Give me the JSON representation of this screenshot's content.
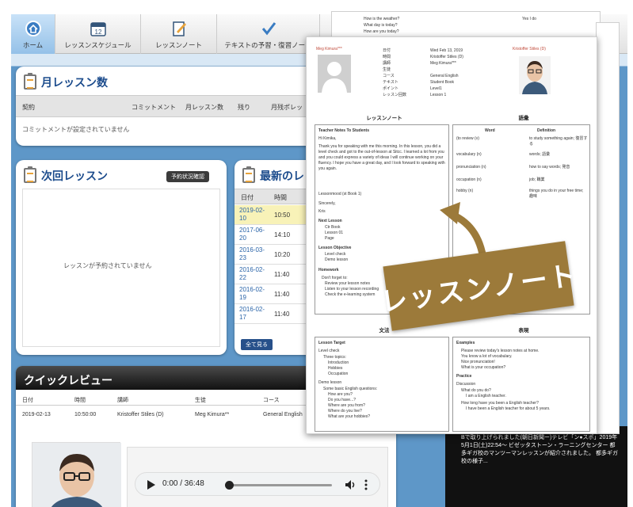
{
  "nav": {
    "tabs": [
      {
        "label": "ホーム",
        "icon": "home-icon"
      },
      {
        "label": "レッスンスケジュール",
        "icon": "calendar-icon"
      },
      {
        "label": "レッスンノート",
        "icon": "note-icon"
      },
      {
        "label": "テキストの予習・復習ノート",
        "icon": "checkmark-icon"
      }
    ],
    "calendar_day": "12"
  },
  "monthly": {
    "title": "月レッスン数",
    "headers": [
      "契約",
      "コミットメント",
      "月レッスン数",
      "残り",
      "月残ポレッ"
    ],
    "empty": "コミットメントが設定されていません"
  },
  "next_lesson": {
    "title": "次回レッスン",
    "button": "予約状況確認",
    "empty": "レッスンが予約されていません"
  },
  "recent": {
    "title": "最新のレッスン",
    "headers": [
      "日付",
      "時間"
    ],
    "rows": [
      {
        "date": "2019-02-10",
        "time": "10:50"
      },
      {
        "date": "2017-06-20",
        "time": "14:10"
      },
      {
        "date": "2016-03-23",
        "time": "10:20"
      },
      {
        "date": "2016-02-22",
        "time": "11:40"
      },
      {
        "date": "2016-02-19",
        "time": "11:40"
      },
      {
        "date": "2016-02-17",
        "time": "11:40"
      }
    ],
    "more": "全て見る"
  },
  "quick_review": {
    "title": "クイックレビュー",
    "headers": [
      "日付",
      "時間",
      "講師",
      "生徒",
      "コース"
    ],
    "values": [
      "2019-02-13",
      "10:50:00",
      "Kristoffer Stiles (D)",
      "Meg Kimura**",
      "General English"
    ]
  },
  "audio": {
    "time": "0:00 / 36:48"
  },
  "report": {
    "student_name": "Meg Kimura***",
    "teacher_name": "Kristoffer Stiles (D)",
    "info_labels": [
      "日付",
      "時間",
      "講師",
      "生徒",
      "コース",
      "テキスト",
      "ポイント",
      "レッスン回数"
    ],
    "info_values": [
      "Wed Feb 13, 2019",
      "Kristoffer Stiles (D)",
      "Meg Kimura***",
      "",
      "General English",
      "Student Book",
      "Level1",
      "Lesson 1"
    ],
    "top_fragments": [
      "How is the weather?",
      "What day is today?",
      "How are you today?",
      "Yes I do"
    ],
    "sec_note": "レッスンノート",
    "sec_vocab": "語彙",
    "sec_expressions": "文法",
    "sec_usage": "表現",
    "note_heading": "Teacher Notes To Students",
    "note_greeting": "Hi Kimika,",
    "note_body": "Thank you for speaking with me this morning. In this lesson, you did a level check and got to the out-of-lesson at Sitcc. I learned a lot from you and you could express a variety of ideas I will continue working on your fluency. I hope you have a great day, and I look forward to speaking with you again.",
    "note_items": [
      "Lessonmood (st Book 1)",
      "Sincerely,",
      "Kris",
      "Next Lesson",
      "Ctr Book",
      "Lesson 01",
      "Page",
      "Lesson Objective",
      "Level check",
      "Demo lesson",
      "Homework",
      "Don't forget to:",
      "Review your lesson notes",
      "Listen to your lesson recording",
      "Check the e-learning system"
    ],
    "vocab_headers": [
      "Word",
      "Definition"
    ],
    "vocab": [
      {
        "word": "(to review (v)",
        "def": "to study something again; 復習する"
      },
      {
        "word": "vocabulary (n)",
        "def": "words; 語彙"
      },
      {
        "word": "pronunciation (n)",
        "def": "how to say words; 発音"
      },
      {
        "word": "occupation (n)",
        "def": "job; 職業"
      },
      {
        "word": "hobby (n)",
        "def": "things you do in your free time; 趣味"
      }
    ],
    "grammar_items": [
      "Lesson Target",
      "Level check",
      "Three topics:",
      "Introduction",
      "Hobbies",
      "Occupation",
      "Demo lesson",
      "Some basic English questions:",
      "How are you?",
      "Do you have...?",
      "Where are you from?",
      "Where do you live?",
      "What are your hobbies?"
    ],
    "usage_items": [
      "Examples",
      "Please review today's lesson notes at home.",
      "You know a lot of vocabulary.",
      "Nice pronunciation!",
      "What is your occupation?",
      "Practice",
      "Discussion",
      "What do you do?",
      "I am a English teacher.",
      "How long have you been a English teacher?",
      "I have been a English teacher for about 5 years."
    ],
    "side_jp": "Bで取り上げられました(朝日新聞ー)テレビ「ン●スポ」2019年5月1日(土)22:54〜 ビゼッタストーン・ラーニングセンター 都多ギガ校のマンツーマンレッスンが紹介されました。 都多ギガ校の様子..."
  },
  "banner": {
    "text": "レッスンノート"
  },
  "colors": {
    "page_blue": "#5e97c8",
    "title_blue": "#1b4b8c",
    "highlight": "#f8f2b8",
    "banner_gold": "#9c7a3a"
  }
}
